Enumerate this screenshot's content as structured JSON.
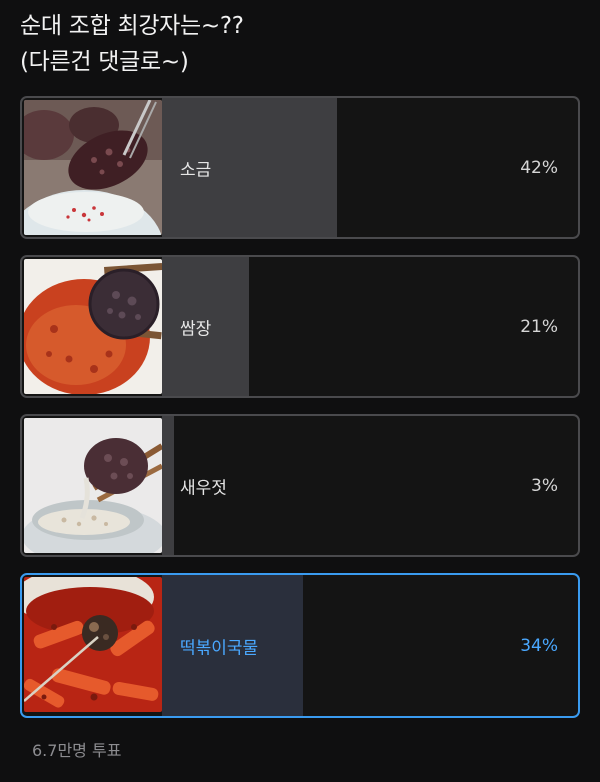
{
  "poll": {
    "question_line1": "순대 조합 최강자는~??",
    "question_line2": "(다른건 댓글로~)",
    "options": [
      {
        "label": "소금",
        "percent_text": "42%",
        "percent": 42,
        "selected": false
      },
      {
        "label": "쌈장",
        "percent_text": "21%",
        "percent": 21,
        "selected": false
      },
      {
        "label": "새우젓",
        "percent_text": "3%",
        "percent": 3,
        "selected": false
      },
      {
        "label": "떡볶이국물",
        "percent_text": "34%",
        "percent": 34,
        "selected": true
      }
    ],
    "vote_count": "6.7만명 투표"
  },
  "colors": {
    "background": "#0f0f10",
    "option_border": "#4a4a4d",
    "selected_border": "#3a9bf0",
    "bar_fill": "#3e3e41",
    "selected_fill": "#2a2f3c",
    "selected_text": "#4aa8ff"
  }
}
